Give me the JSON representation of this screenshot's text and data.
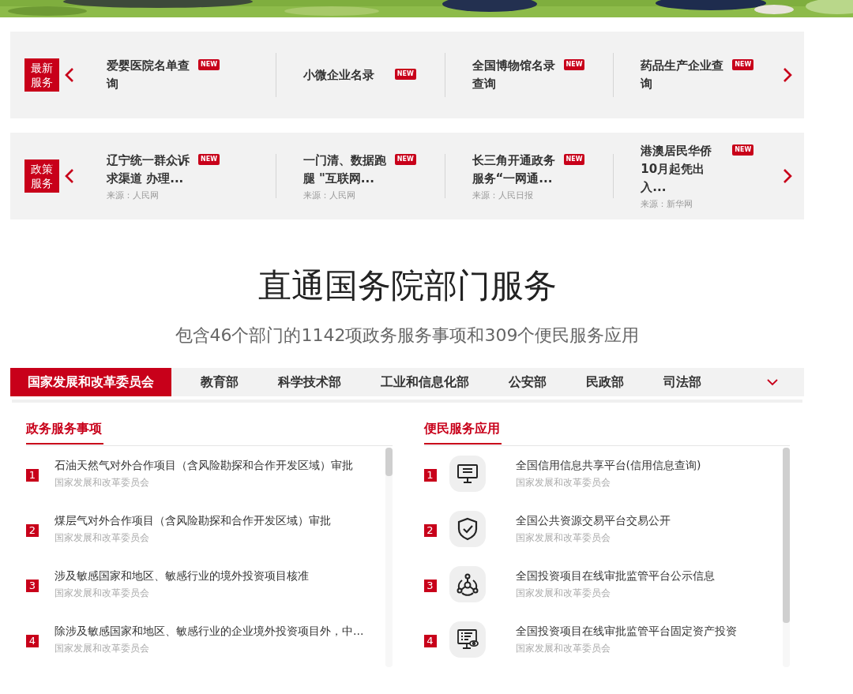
{
  "news_panels": [
    {
      "label": "最新服务",
      "items": [
        {
          "title": "爱婴医院名单查询",
          "badge": "NEW"
        },
        {
          "title": "小微企业名录",
          "badge": "NEW"
        },
        {
          "title": "全国博物馆名录查询",
          "badge": "NEW"
        },
        {
          "title": "药品生产企业查询",
          "badge": "NEW"
        }
      ]
    },
    {
      "label": "政策服务",
      "items": [
        {
          "title": "辽宁统一群众诉求渠道 办理...",
          "badge": "NEW",
          "source": "来源：人民网"
        },
        {
          "title": "一门清、数据跑腿 \"互联网...",
          "badge": "NEW",
          "source": "来源：人民网"
        },
        {
          "title": "长三角开通政务服务“一网通...",
          "badge": "NEW",
          "source": "来源：人民日报"
        },
        {
          "title": "港澳居民华侨10月起凭出入...",
          "badge": "NEW",
          "source": "来源：新华网"
        }
      ]
    }
  ],
  "section": {
    "title": "直通国务院部门服务",
    "subtitle": "包含46个部门的1142项政务服务事项和309个便民服务应用"
  },
  "department_tabs": [
    {
      "label": "国家发展和改革委员会",
      "selected": true
    },
    {
      "label": "教育部",
      "selected": false
    },
    {
      "label": "科学技术部",
      "selected": false
    },
    {
      "label": "工业和信息化部",
      "selected": false
    },
    {
      "label": "公安部",
      "selected": false
    },
    {
      "label": "民政部",
      "selected": false
    },
    {
      "label": "司法部",
      "selected": false
    }
  ],
  "lists": [
    {
      "heading": "政务服务事项",
      "items": [
        {
          "number": "1",
          "title": "石油天然气对外合作项目（含风险勘探和合作开发区域）审批",
          "department": "国家发展和改革委员会"
        },
        {
          "number": "2",
          "title": "煤层气对外合作项目（含风险勘探和合作开发区域）审批",
          "department": "国家发展和改革委员会"
        },
        {
          "number": "3",
          "title": "涉及敏感国家和地区、敏感行业的境外投资项目核准",
          "department": "国家发展和改革委员会"
        },
        {
          "number": "4",
          "title": "除涉及敏感国家和地区、敏感行业的企业境外投资项目外，中...",
          "department": "国家发展和改革委员会"
        }
      ]
    },
    {
      "heading": "便民服务应用",
      "items": [
        {
          "number": "1",
          "title": "全国信用信息共享平台(信用信息查询)",
          "department": "国家发展和改革委员会"
        },
        {
          "number": "2",
          "title": "全国公共资源交易平台交易公开",
          "department": "国家发展和改革委员会"
        },
        {
          "number": "3",
          "title": "全国投资项目在线审批监管平台公示信息",
          "department": "国家发展和改革委员会"
        },
        {
          "number": "4",
          "title": "全国投资项目在线审批监管平台固定资产投资",
          "department": "国家发展和改革委员会"
        }
      ]
    }
  ]
}
